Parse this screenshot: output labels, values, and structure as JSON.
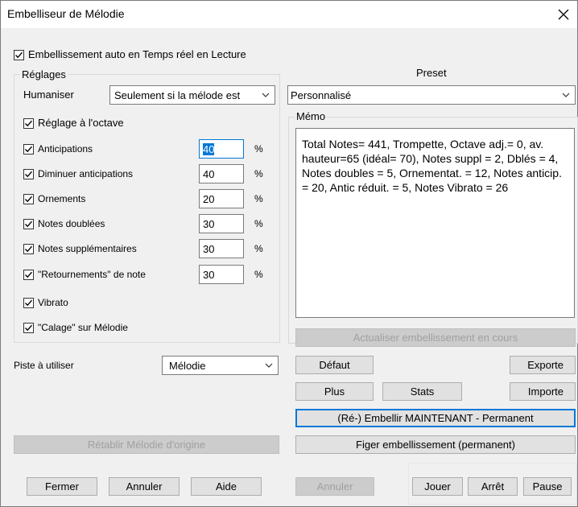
{
  "window": {
    "title": "Embelliseur de Mélodie",
    "close_glyph": "✕"
  },
  "auto_realtime": {
    "label": "Embellissement auto en Temps réel en Lecture",
    "checked": true
  },
  "settings": {
    "group_label": "Réglages",
    "humanize_label": "Humaniser",
    "humanize_value": "Seulement si la mélode est",
    "octave": {
      "label": "Réglage à l'octave",
      "checked": true
    },
    "rows": [
      {
        "label": "Anticipations",
        "value": "40",
        "unit": "%",
        "checked": true,
        "focused": true
      },
      {
        "label": "Diminuer anticipations",
        "value": "40",
        "unit": "%",
        "checked": true
      },
      {
        "label": "Ornements",
        "value": "20",
        "unit": "%",
        "checked": true
      },
      {
        "label": "Notes doublées",
        "value": "30",
        "unit": "%",
        "checked": true
      },
      {
        "label": "Notes supplémentaires",
        "value": "30",
        "unit": "%",
        "checked": true
      },
      {
        "label": "\"Retournements\" de note",
        "value": "30",
        "unit": "%",
        "checked": true
      }
    ],
    "vibrato": {
      "label": "Vibrato",
      "checked": true
    },
    "calage": {
      "label": "\"Calage\" sur Mélodie",
      "checked": true
    }
  },
  "track": {
    "label": "Piste à utiliser",
    "value": "Mélodie"
  },
  "preset": {
    "label": "Preset",
    "value": "Personnalisé",
    "memo_label": "Mémo",
    "memo_text": "Total Notes= 441,  Trompette, Octave adj.= 0, av. hauteur=65 (idéal= 70), Notes suppl = 2,  Dblés = 4,  Notes doubles = 5, Ornementat. = 12,  Notes anticip. = 20, Antic réduit. = 5,  Notes Vibrato = 26"
  },
  "buttons": {
    "update_current": "Actualiser embellissement en cours",
    "default": "Défaut",
    "export": "Exporte",
    "plus": "Plus",
    "stats": "Stats",
    "import": "Importe",
    "re_embellish": "(Ré-) Embellir MAINTENANT - Permanent",
    "freeze": "Figer embellissement (permanent)",
    "restore": "Rétablir Mélodie d'origine",
    "close": "Fermer",
    "cancel": "Annuler",
    "help": "Aide",
    "cancel2": "Annuler",
    "play": "Jouer",
    "stop": "Arrêt",
    "pause": "Pause"
  },
  "icons": {
    "check": "check-mark-icon",
    "dropdown": "chevron-down-icon",
    "close": "close-icon"
  }
}
